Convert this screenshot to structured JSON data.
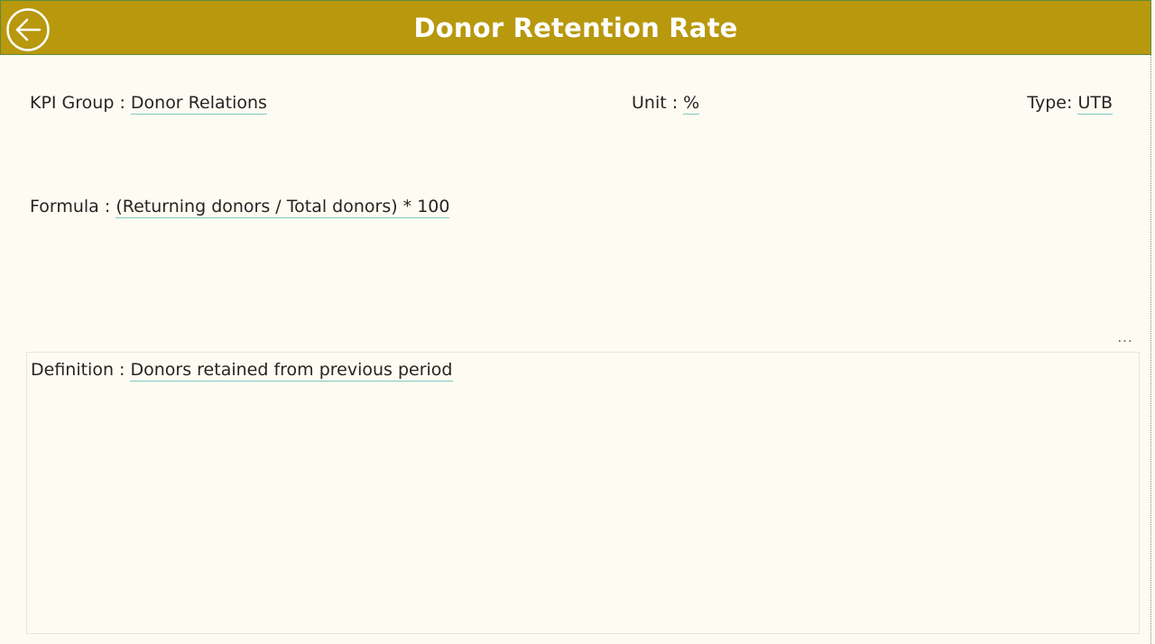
{
  "header": {
    "title": "Donor Retention Rate",
    "back_icon": "back-arrow-circle-icon",
    "background_color": "#b8980d"
  },
  "fields": {
    "kpi_group": {
      "label": "KPI Group : ",
      "value": "Donor Relations"
    },
    "unit": {
      "label": "Unit : ",
      "value": "%"
    },
    "type": {
      "label": "Type: ",
      "value": "UTB"
    },
    "formula": {
      "label": "Formula : ",
      "value": "(Returning donors / Total donors) * 100"
    },
    "definition": {
      "label": "Definition : ",
      "value": "Donors retained from previous period"
    }
  },
  "visual": {
    "more_options_label": "...",
    "more_options_icon": "more-options-icon"
  },
  "colors": {
    "underline": "#7fc8c2",
    "page_background": "#fefcf2"
  }
}
